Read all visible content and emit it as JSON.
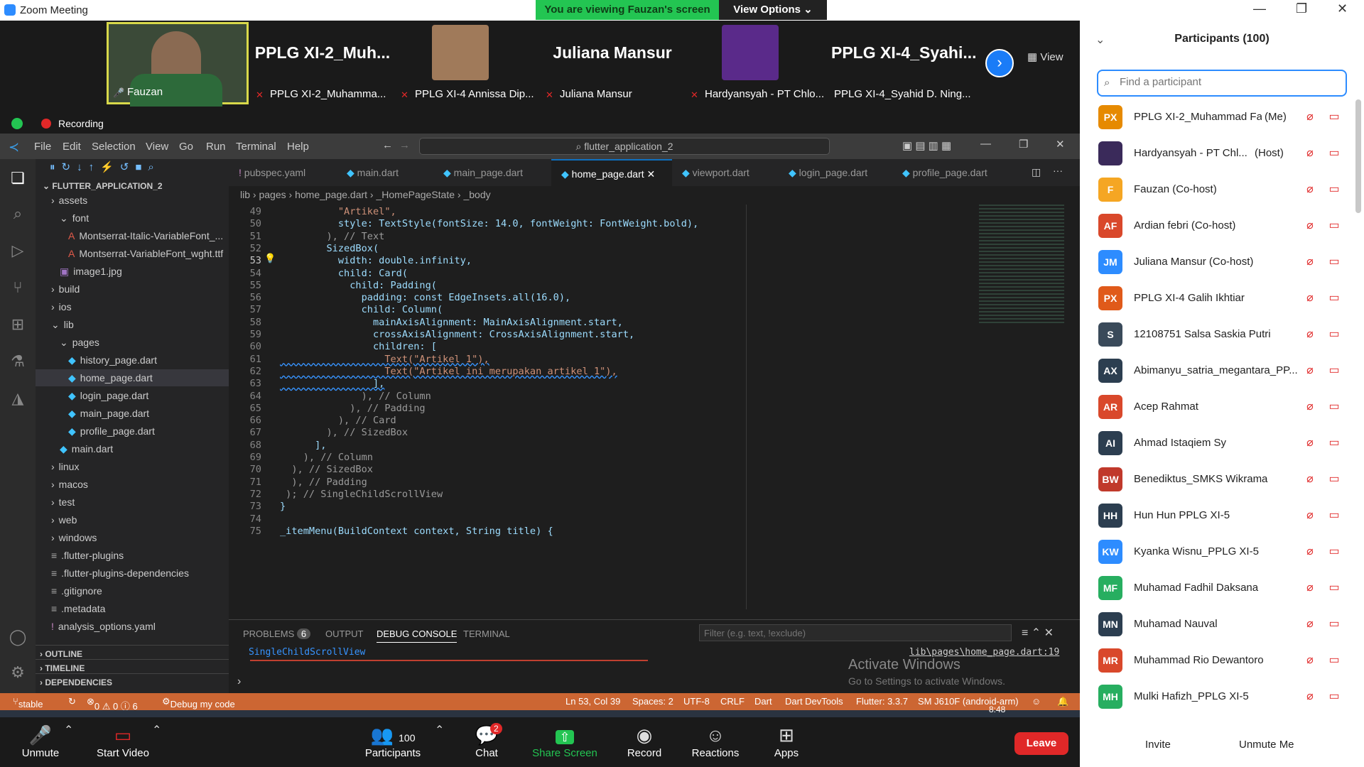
{
  "window": {
    "title": "Zoom Meeting"
  },
  "banner": {
    "viewing": "You are viewing Fauzan's screen",
    "options": "View Options"
  },
  "strip": {
    "tiles": [
      {
        "name": "Fauzan"
      },
      {
        "big": "PPLG XI-2_Muh...",
        "name": "PPLG XI-2_Muhamma..."
      },
      {
        "name": "PPLG XI-4 Annissa Dip..."
      },
      {
        "big": "Juliana Mansur",
        "name": "Juliana Mansur"
      },
      {
        "name": "Hardyansyah - PT Chlo..."
      },
      {
        "big": "PPLG XI-4_Syahi...",
        "name": "PPLG XI-4_Syahid D. Ning..."
      }
    ],
    "view_label": "View"
  },
  "recording": "Recording",
  "vscode": {
    "menu": [
      "File",
      "Edit",
      "Selection",
      "View",
      "Go",
      "Run",
      "Terminal",
      "Help"
    ],
    "command_center": "flutter_application_2",
    "explorer_title": "FLUTTER_APPLICATION_2",
    "tree": [
      {
        "label": "assets",
        "indent": 1,
        "kind": "folder"
      },
      {
        "label": "font",
        "indent": 2,
        "kind": "folder-open"
      },
      {
        "label": "Montserrat-Italic-VariableFont_...",
        "indent": 3,
        "kind": "font"
      },
      {
        "label": "Montserrat-VariableFont_wght.ttf",
        "indent": 3,
        "kind": "font"
      },
      {
        "label": "image1.jpg",
        "indent": 2,
        "kind": "image"
      },
      {
        "label": "build",
        "indent": 1,
        "kind": "folder"
      },
      {
        "label": "ios",
        "indent": 1,
        "kind": "folder"
      },
      {
        "label": "lib",
        "indent": 1,
        "kind": "folder-open"
      },
      {
        "label": "pages",
        "indent": 2,
        "kind": "folder-open"
      },
      {
        "label": "history_page.dart",
        "indent": 3,
        "kind": "dart"
      },
      {
        "label": "home_page.dart",
        "indent": 3,
        "kind": "dart",
        "selected": true
      },
      {
        "label": "login_page.dart",
        "indent": 3,
        "kind": "dart"
      },
      {
        "label": "main_page.dart",
        "indent": 3,
        "kind": "dart"
      },
      {
        "label": "profile_page.dart",
        "indent": 3,
        "kind": "dart"
      },
      {
        "label": "main.dart",
        "indent": 2,
        "kind": "dart"
      },
      {
        "label": "linux",
        "indent": 1,
        "kind": "folder"
      },
      {
        "label": "macos",
        "indent": 1,
        "kind": "folder"
      },
      {
        "label": "test",
        "indent": 1,
        "kind": "folder"
      },
      {
        "label": "web",
        "indent": 1,
        "kind": "folder"
      },
      {
        "label": "windows",
        "indent": 1,
        "kind": "folder"
      },
      {
        "label": ".flutter-plugins",
        "indent": 1,
        "kind": "file"
      },
      {
        "label": ".flutter-plugins-dependencies",
        "indent": 1,
        "kind": "file"
      },
      {
        "label": ".gitignore",
        "indent": 1,
        "kind": "file"
      },
      {
        "label": ".metadata",
        "indent": 1,
        "kind": "file"
      },
      {
        "label": "analysis_options.yaml",
        "indent": 1,
        "kind": "yaml"
      }
    ],
    "sections": [
      "OUTLINE",
      "TIMELINE",
      "DEPENDENCIES"
    ],
    "tabs": [
      "pubspec.yaml",
      "main.dart",
      "main_page.dart",
      "home_page.dart",
      "viewport.dart",
      "login_page.dart",
      "profile_page.dart"
    ],
    "active_tab": "home_page.dart",
    "breadcrumbs": [
      "lib",
      "pages",
      "home_page.dart",
      "_HomePageState",
      "_body"
    ],
    "code": [
      {
        "n": "49",
        "t": "          \"Artikel\","
      },
      {
        "n": "50",
        "t": "          style: TextStyle(fontSize: 14.0, fontWeight: FontWeight.bold),"
      },
      {
        "n": "51",
        "t": "        ), // Text"
      },
      {
        "n": "52",
        "t": "        SizedBox("
      },
      {
        "n": "53",
        "t": "          width: double.infinity,"
      },
      {
        "n": "54",
        "t": "          child: Card("
      },
      {
        "n": "55",
        "t": "            child: Padding("
      },
      {
        "n": "56",
        "t": "              padding: const EdgeInsets.all(16.0),"
      },
      {
        "n": "57",
        "t": "              child: Column("
      },
      {
        "n": "58",
        "t": "                mainAxisAlignment: MainAxisAlignment.start,"
      },
      {
        "n": "59",
        "t": "                crossAxisAlignment: CrossAxisAlignment.start,"
      },
      {
        "n": "60",
        "t": "                children: ["
      },
      {
        "n": "61",
        "t": "                  Text(\"Artikel 1\"),"
      },
      {
        "n": "62",
        "t": "                  Text(\"Artikel ini merupakan artikel 1\"),"
      },
      {
        "n": "63",
        "t": "                ],"
      },
      {
        "n": "64",
        "t": "              ), // Column"
      },
      {
        "n": "65",
        "t": "            ), // Padding"
      },
      {
        "n": "66",
        "t": "          ), // Card"
      },
      {
        "n": "67",
        "t": "        ), // SizedBox"
      },
      {
        "n": "68",
        "t": "      ],"
      },
      {
        "n": "69",
        "t": "    ), // Column"
      },
      {
        "n": "70",
        "t": "  ), // SizedBox"
      },
      {
        "n": "71",
        "t": "  ), // Padding"
      },
      {
        "n": "72",
        "t": " ); // SingleChildScrollView"
      },
      {
        "n": "73",
        "t": "}"
      },
      {
        "n": "74",
        "t": ""
      },
      {
        "n": "75",
        "t": "_itemMenu(BuildContext context, String title) {"
      }
    ],
    "panel": {
      "tabs": [
        "PROBLEMS",
        "OUTPUT",
        "DEBUG CONSOLE",
        "TERMINAL"
      ],
      "problems_count": "6",
      "filter_placeholder": "Filter (e.g. text, !exclude)",
      "console_line": "SingleChildScrollView",
      "console_link": "lib\\pages\\home_page.dart:19",
      "activate_title": "Activate Windows",
      "activate_sub": "Go to Settings to activate Windows."
    },
    "status": {
      "branch": "stable",
      "problems": "0 ⚠ 0 ⓘ 6",
      "debug": "Debug my code",
      "position": "Ln 53, Col 39",
      "spaces": "Spaces: 2",
      "encoding": "UTF-8",
      "eol": "CRLF",
      "language": "Dart",
      "devtools": "Dart DevTools",
      "flutter": "Flutter: 3.3.7",
      "device": "SM J610F (android-arm)"
    }
  },
  "zoombar": {
    "unmute": "Unmute",
    "start_video": "Start Video",
    "participants": "Participants",
    "participants_count": "100",
    "chat": "Chat",
    "chat_badge": "2",
    "share": "Share Screen",
    "record": "Record",
    "reactions": "Reactions",
    "apps": "Apps",
    "leave": "Leave",
    "time": "8:48"
  },
  "participants_panel": {
    "title": "Participants (100)",
    "search_placeholder": "Find a participant",
    "list": [
      {
        "initials": "PX",
        "color": "#e68a00",
        "name": "PPLG XI-2_Muhammad Fad...",
        "role": "(Me)"
      },
      {
        "initials": "",
        "color": "#3a2a5a",
        "name": "Hardyansyah - PT Chl...",
        "role": "(Host)"
      },
      {
        "initials": "F",
        "color": "#f5a623",
        "name": "Fauzan (Co-host)",
        "role": ""
      },
      {
        "initials": "AF",
        "color": "#d9482b",
        "name": "Ardian febri (Co-host)",
        "role": ""
      },
      {
        "initials": "JM",
        "color": "#2d8cff",
        "name": "Juliana Mansur (Co-host)",
        "role": ""
      },
      {
        "initials": "PX",
        "color": "#e05a1a",
        "name": "PPLG XI-4 Galih Ikhtiar",
        "role": ""
      },
      {
        "initials": "S",
        "color": "#3a4a5a",
        "name": "12108751 Salsa Saskia Putri",
        "role": ""
      },
      {
        "initials": "AX",
        "color": "#2c3e50",
        "name": "Abimanyu_satria_megantara_PP...",
        "role": ""
      },
      {
        "initials": "AR",
        "color": "#d9482b",
        "name": "Acep Rahmat",
        "role": ""
      },
      {
        "initials": "AI",
        "color": "#2c3e50",
        "name": "Ahmad Istaqiem Sy",
        "role": ""
      },
      {
        "initials": "BW",
        "color": "#c0392b",
        "name": "Benediktus_SMKS Wikrama",
        "role": ""
      },
      {
        "initials": "HH",
        "color": "#2c3e50",
        "name": "Hun Hun PPLG XI-5",
        "role": ""
      },
      {
        "initials": "KW",
        "color": "#2d8cff",
        "name": "Kyanka Wisnu_PPLG XI-5",
        "role": ""
      },
      {
        "initials": "MF",
        "color": "#27ae60",
        "name": "Muhamad Fadhil Daksana",
        "role": ""
      },
      {
        "initials": "MN",
        "color": "#2c3e50",
        "name": "Muhamad Nauval",
        "role": ""
      },
      {
        "initials": "MR",
        "color": "#d9482b",
        "name": "Muhammad Rio Dewantoro",
        "role": ""
      },
      {
        "initials": "MH",
        "color": "#27ae60",
        "name": "Mulki Hafizh_PPLG XI-5",
        "role": ""
      }
    ],
    "invite": "Invite",
    "unmute_me": "Unmute Me"
  }
}
